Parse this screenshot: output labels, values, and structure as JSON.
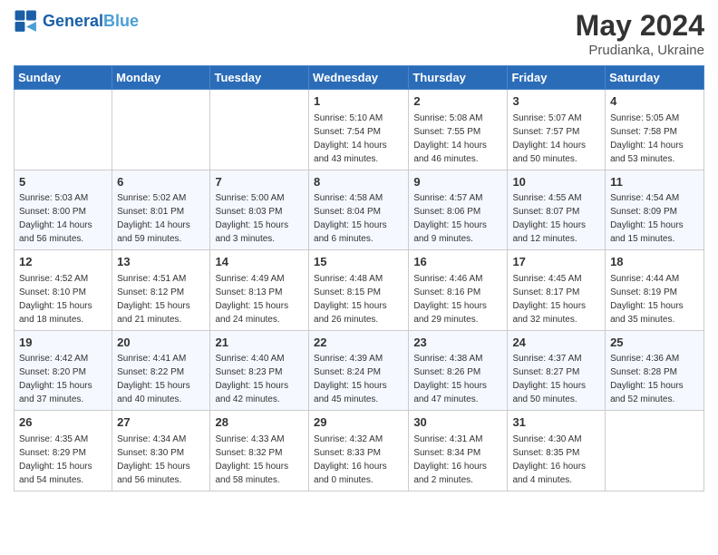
{
  "header": {
    "logo_general": "General",
    "logo_blue": "Blue",
    "title": "May 2024",
    "subtitle": "Prudianka, Ukraine"
  },
  "days_of_week": [
    "Sunday",
    "Monday",
    "Tuesday",
    "Wednesday",
    "Thursday",
    "Friday",
    "Saturday"
  ],
  "weeks": [
    [
      {
        "day": "",
        "sunrise": "",
        "sunset": "",
        "daylight": ""
      },
      {
        "day": "",
        "sunrise": "",
        "sunset": "",
        "daylight": ""
      },
      {
        "day": "",
        "sunrise": "",
        "sunset": "",
        "daylight": ""
      },
      {
        "day": "1",
        "sunrise": "Sunrise: 5:10 AM",
        "sunset": "Sunset: 7:54 PM",
        "daylight": "Daylight: 14 hours and 43 minutes."
      },
      {
        "day": "2",
        "sunrise": "Sunrise: 5:08 AM",
        "sunset": "Sunset: 7:55 PM",
        "daylight": "Daylight: 14 hours and 46 minutes."
      },
      {
        "day": "3",
        "sunrise": "Sunrise: 5:07 AM",
        "sunset": "Sunset: 7:57 PM",
        "daylight": "Daylight: 14 hours and 50 minutes."
      },
      {
        "day": "4",
        "sunrise": "Sunrise: 5:05 AM",
        "sunset": "Sunset: 7:58 PM",
        "daylight": "Daylight: 14 hours and 53 minutes."
      }
    ],
    [
      {
        "day": "5",
        "sunrise": "Sunrise: 5:03 AM",
        "sunset": "Sunset: 8:00 PM",
        "daylight": "Daylight: 14 hours and 56 minutes."
      },
      {
        "day": "6",
        "sunrise": "Sunrise: 5:02 AM",
        "sunset": "Sunset: 8:01 PM",
        "daylight": "Daylight: 14 hours and 59 minutes."
      },
      {
        "day": "7",
        "sunrise": "Sunrise: 5:00 AM",
        "sunset": "Sunset: 8:03 PM",
        "daylight": "Daylight: 15 hours and 3 minutes."
      },
      {
        "day": "8",
        "sunrise": "Sunrise: 4:58 AM",
        "sunset": "Sunset: 8:04 PM",
        "daylight": "Daylight: 15 hours and 6 minutes."
      },
      {
        "day": "9",
        "sunrise": "Sunrise: 4:57 AM",
        "sunset": "Sunset: 8:06 PM",
        "daylight": "Daylight: 15 hours and 9 minutes."
      },
      {
        "day": "10",
        "sunrise": "Sunrise: 4:55 AM",
        "sunset": "Sunset: 8:07 PM",
        "daylight": "Daylight: 15 hours and 12 minutes."
      },
      {
        "day": "11",
        "sunrise": "Sunrise: 4:54 AM",
        "sunset": "Sunset: 8:09 PM",
        "daylight": "Daylight: 15 hours and 15 minutes."
      }
    ],
    [
      {
        "day": "12",
        "sunrise": "Sunrise: 4:52 AM",
        "sunset": "Sunset: 8:10 PM",
        "daylight": "Daylight: 15 hours and 18 minutes."
      },
      {
        "day": "13",
        "sunrise": "Sunrise: 4:51 AM",
        "sunset": "Sunset: 8:12 PM",
        "daylight": "Daylight: 15 hours and 21 minutes."
      },
      {
        "day": "14",
        "sunrise": "Sunrise: 4:49 AM",
        "sunset": "Sunset: 8:13 PM",
        "daylight": "Daylight: 15 hours and 24 minutes."
      },
      {
        "day": "15",
        "sunrise": "Sunrise: 4:48 AM",
        "sunset": "Sunset: 8:15 PM",
        "daylight": "Daylight: 15 hours and 26 minutes."
      },
      {
        "day": "16",
        "sunrise": "Sunrise: 4:46 AM",
        "sunset": "Sunset: 8:16 PM",
        "daylight": "Daylight: 15 hours and 29 minutes."
      },
      {
        "day": "17",
        "sunrise": "Sunrise: 4:45 AM",
        "sunset": "Sunset: 8:17 PM",
        "daylight": "Daylight: 15 hours and 32 minutes."
      },
      {
        "day": "18",
        "sunrise": "Sunrise: 4:44 AM",
        "sunset": "Sunset: 8:19 PM",
        "daylight": "Daylight: 15 hours and 35 minutes."
      }
    ],
    [
      {
        "day": "19",
        "sunrise": "Sunrise: 4:42 AM",
        "sunset": "Sunset: 8:20 PM",
        "daylight": "Daylight: 15 hours and 37 minutes."
      },
      {
        "day": "20",
        "sunrise": "Sunrise: 4:41 AM",
        "sunset": "Sunset: 8:22 PM",
        "daylight": "Daylight: 15 hours and 40 minutes."
      },
      {
        "day": "21",
        "sunrise": "Sunrise: 4:40 AM",
        "sunset": "Sunset: 8:23 PM",
        "daylight": "Daylight: 15 hours and 42 minutes."
      },
      {
        "day": "22",
        "sunrise": "Sunrise: 4:39 AM",
        "sunset": "Sunset: 8:24 PM",
        "daylight": "Daylight: 15 hours and 45 minutes."
      },
      {
        "day": "23",
        "sunrise": "Sunrise: 4:38 AM",
        "sunset": "Sunset: 8:26 PM",
        "daylight": "Daylight: 15 hours and 47 minutes."
      },
      {
        "day": "24",
        "sunrise": "Sunrise: 4:37 AM",
        "sunset": "Sunset: 8:27 PM",
        "daylight": "Daylight: 15 hours and 50 minutes."
      },
      {
        "day": "25",
        "sunrise": "Sunrise: 4:36 AM",
        "sunset": "Sunset: 8:28 PM",
        "daylight": "Daylight: 15 hours and 52 minutes."
      }
    ],
    [
      {
        "day": "26",
        "sunrise": "Sunrise: 4:35 AM",
        "sunset": "Sunset: 8:29 PM",
        "daylight": "Daylight: 15 hours and 54 minutes."
      },
      {
        "day": "27",
        "sunrise": "Sunrise: 4:34 AM",
        "sunset": "Sunset: 8:30 PM",
        "daylight": "Daylight: 15 hours and 56 minutes."
      },
      {
        "day": "28",
        "sunrise": "Sunrise: 4:33 AM",
        "sunset": "Sunset: 8:32 PM",
        "daylight": "Daylight: 15 hours and 58 minutes."
      },
      {
        "day": "29",
        "sunrise": "Sunrise: 4:32 AM",
        "sunset": "Sunset: 8:33 PM",
        "daylight": "Daylight: 16 hours and 0 minutes."
      },
      {
        "day": "30",
        "sunrise": "Sunrise: 4:31 AM",
        "sunset": "Sunset: 8:34 PM",
        "daylight": "Daylight: 16 hours and 2 minutes."
      },
      {
        "day": "31",
        "sunrise": "Sunrise: 4:30 AM",
        "sunset": "Sunset: 8:35 PM",
        "daylight": "Daylight: 16 hours and 4 minutes."
      },
      {
        "day": "",
        "sunrise": "",
        "sunset": "",
        "daylight": ""
      }
    ]
  ]
}
